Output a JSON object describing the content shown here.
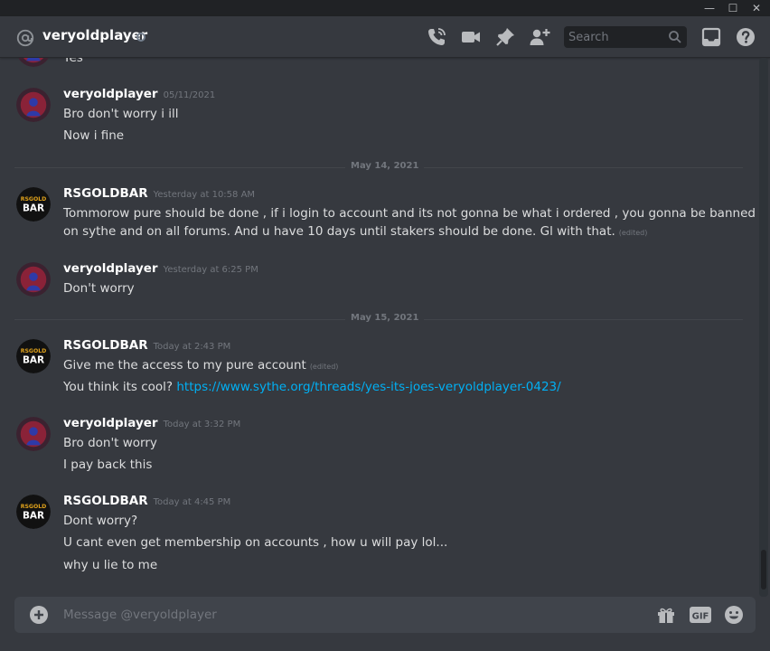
{
  "header": {
    "title": "veryoldplayer",
    "search_placeholder": "Search"
  },
  "window": {
    "minimize": "—",
    "maximize": "☐",
    "close": "✕"
  },
  "messages": [
    {
      "kind": "partial",
      "lines": [
        "Yes"
      ]
    },
    {
      "author": "veryoldplayer",
      "timestamp": "05/11/2021",
      "avatar": "veryoldplayer",
      "lines": [
        "Bro don't worry i ill",
        "Now i fine"
      ]
    },
    {
      "kind": "divider",
      "label": "May 14, 2021"
    },
    {
      "author": "RSGOLDBAR",
      "timestamp": "Yesterday at 10:58 AM",
      "avatar": "rsgoldbar",
      "lines": [
        "Tommorow pure should be done , if i login to account and its not gonna be what i ordered , you gonna be banned",
        "on sythe and on all forums. And u have 10 days until stakers should be done. Gl with that."
      ],
      "edited": "(edited)"
    },
    {
      "author": "veryoldplayer",
      "timestamp": "Yesterday at 6:25 PM",
      "avatar": "veryoldplayer",
      "lines": [
        "Don't worry"
      ]
    },
    {
      "kind": "divider",
      "label": "May 15, 2021"
    },
    {
      "author": "RSGOLDBAR",
      "timestamp": "Today at 2:43 PM",
      "avatar": "rsgoldbar",
      "lines": [
        "Give me the access to my pure account",
        "You think its cool?"
      ],
      "edited": "(edited)",
      "link": "https://www.sythe.org/threads/yes-its-joes-veryoldplayer-0423/"
    },
    {
      "author": "veryoldplayer",
      "timestamp": "Today at 3:32 PM",
      "avatar": "veryoldplayer",
      "lines": [
        "Bro don't worry",
        "I pay back this"
      ]
    },
    {
      "author": "RSGOLDBAR",
      "timestamp": "Today at 4:45 PM",
      "avatar": "rsgoldbar",
      "lines": [
        "Dont worry?",
        "U cant even get membership on accounts , how u will pay lol...",
        "why u lie to me"
      ]
    }
  ],
  "avatar_text": {
    "rsgoldbar_top": "RSGOLD",
    "rsgoldbar_bottom": "BAR"
  },
  "composer": {
    "placeholder": "Message @veryoldplayer",
    "gif_label": "GIF"
  },
  "colors": {
    "background": "#36393f",
    "link": "#00b0f4",
    "timestamp": "#72767d",
    "author": "#ffffff"
  }
}
